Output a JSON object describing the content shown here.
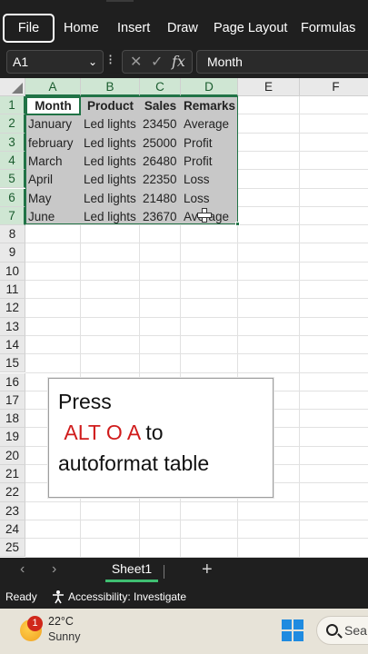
{
  "ribbon": {
    "tabs": [
      "File",
      "Home",
      "Insert",
      "Draw",
      "Page Layout",
      "Formulas"
    ]
  },
  "formula_bar": {
    "name_box": "A1",
    "more_dots": "⁝",
    "fx_symbol": "fx",
    "content": "Month"
  },
  "grid": {
    "columns": [
      "A",
      "B",
      "C",
      "D",
      "E",
      "F"
    ],
    "rows": [
      "1",
      "2",
      "3",
      "4",
      "5",
      "6",
      "7",
      "8",
      "9",
      "10",
      "11",
      "12",
      "13",
      "14",
      "15",
      "16",
      "17",
      "18",
      "19",
      "20",
      "21",
      "22",
      "23",
      "24",
      "25"
    ],
    "table": {
      "headers": [
        "Month",
        "Product",
        "Sales",
        "Remarks"
      ],
      "rows": [
        [
          "January",
          "Led lights",
          "23450",
          "Average"
        ],
        [
          "february",
          "Led lights",
          "25000",
          "Profit"
        ],
        [
          "March",
          "Led lights",
          "26480",
          "Profit"
        ],
        [
          "April",
          "Led lights",
          "22350",
          "Loss"
        ],
        [
          "May",
          "Led lights",
          "21480",
          "Loss"
        ],
        [
          "June",
          "Led lights",
          "23670",
          "Average"
        ]
      ]
    }
  },
  "tip": {
    "line1": "Press",
    "keys": "ALT O A",
    "line2_rest": " to",
    "line3": "autoformat table"
  },
  "sheets": {
    "active": "Sheet1",
    "add": "+",
    "prev": "‹",
    "next": "›"
  },
  "status": {
    "ready": "Ready",
    "accessibility": "Accessibility: Investigate"
  },
  "taskbar": {
    "weather_temp": "22°C",
    "weather_cond": "Sunny",
    "badge": "1",
    "search": "Sea"
  },
  "colors": {
    "accent": "#217346",
    "selection_fill": "#c8c8c8",
    "tip_key": "#d01c1c"
  }
}
